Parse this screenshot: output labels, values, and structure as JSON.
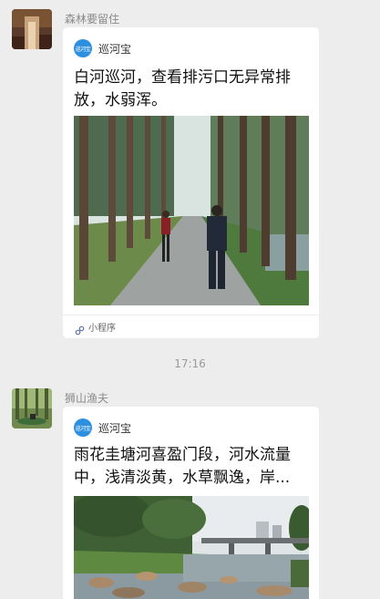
{
  "messages": [
    {
      "sender": "森林要留住",
      "card": {
        "app_logo_text": "巡河宝",
        "app_name": "巡河宝",
        "title": "白河巡河，查看排污口无异常排放，水弱浑。",
        "footer": "小程序"
      }
    },
    {
      "sender": "狮山渔夫",
      "card": {
        "app_logo_text": "巡河宝",
        "app_name": "巡河宝",
        "title": "雨花圭塘河喜盈门段，河水流量中，浅清淡黄，水草飘逸，岸..."
      }
    }
  ],
  "timestamp": "17:16",
  "colors": {
    "background": "#ededed",
    "card": "#ffffff",
    "logo": "#2d8fe0"
  },
  "icons": {
    "mini_program": "mini-program-link-icon"
  }
}
